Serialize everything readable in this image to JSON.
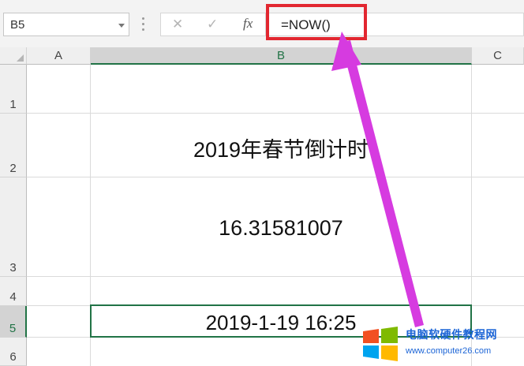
{
  "formula_bar": {
    "name_box": "B5",
    "cancel_symbol": "✕",
    "enter_symbol": "✓",
    "function_symbol": "fx",
    "formula": "=NOW()"
  },
  "columns": [
    "A",
    "B",
    "C"
  ],
  "selected_column": "B",
  "rows": [
    "1",
    "2",
    "3",
    "4",
    "5",
    "6"
  ],
  "selected_row": "5",
  "cells": {
    "B2": "2019年春节倒计时",
    "B3": "16.31581007",
    "B5": "2019-1-19 16:25"
  },
  "annotation": {
    "highlight_color": "#e22730",
    "arrow_color": "#d63be0"
  },
  "watermark": {
    "title": "电脑软硬件教程网",
    "url": "www.computer26.com",
    "logo_colors": [
      "#f25022",
      "#7fba00",
      "#00a4ef",
      "#ffb900"
    ]
  }
}
